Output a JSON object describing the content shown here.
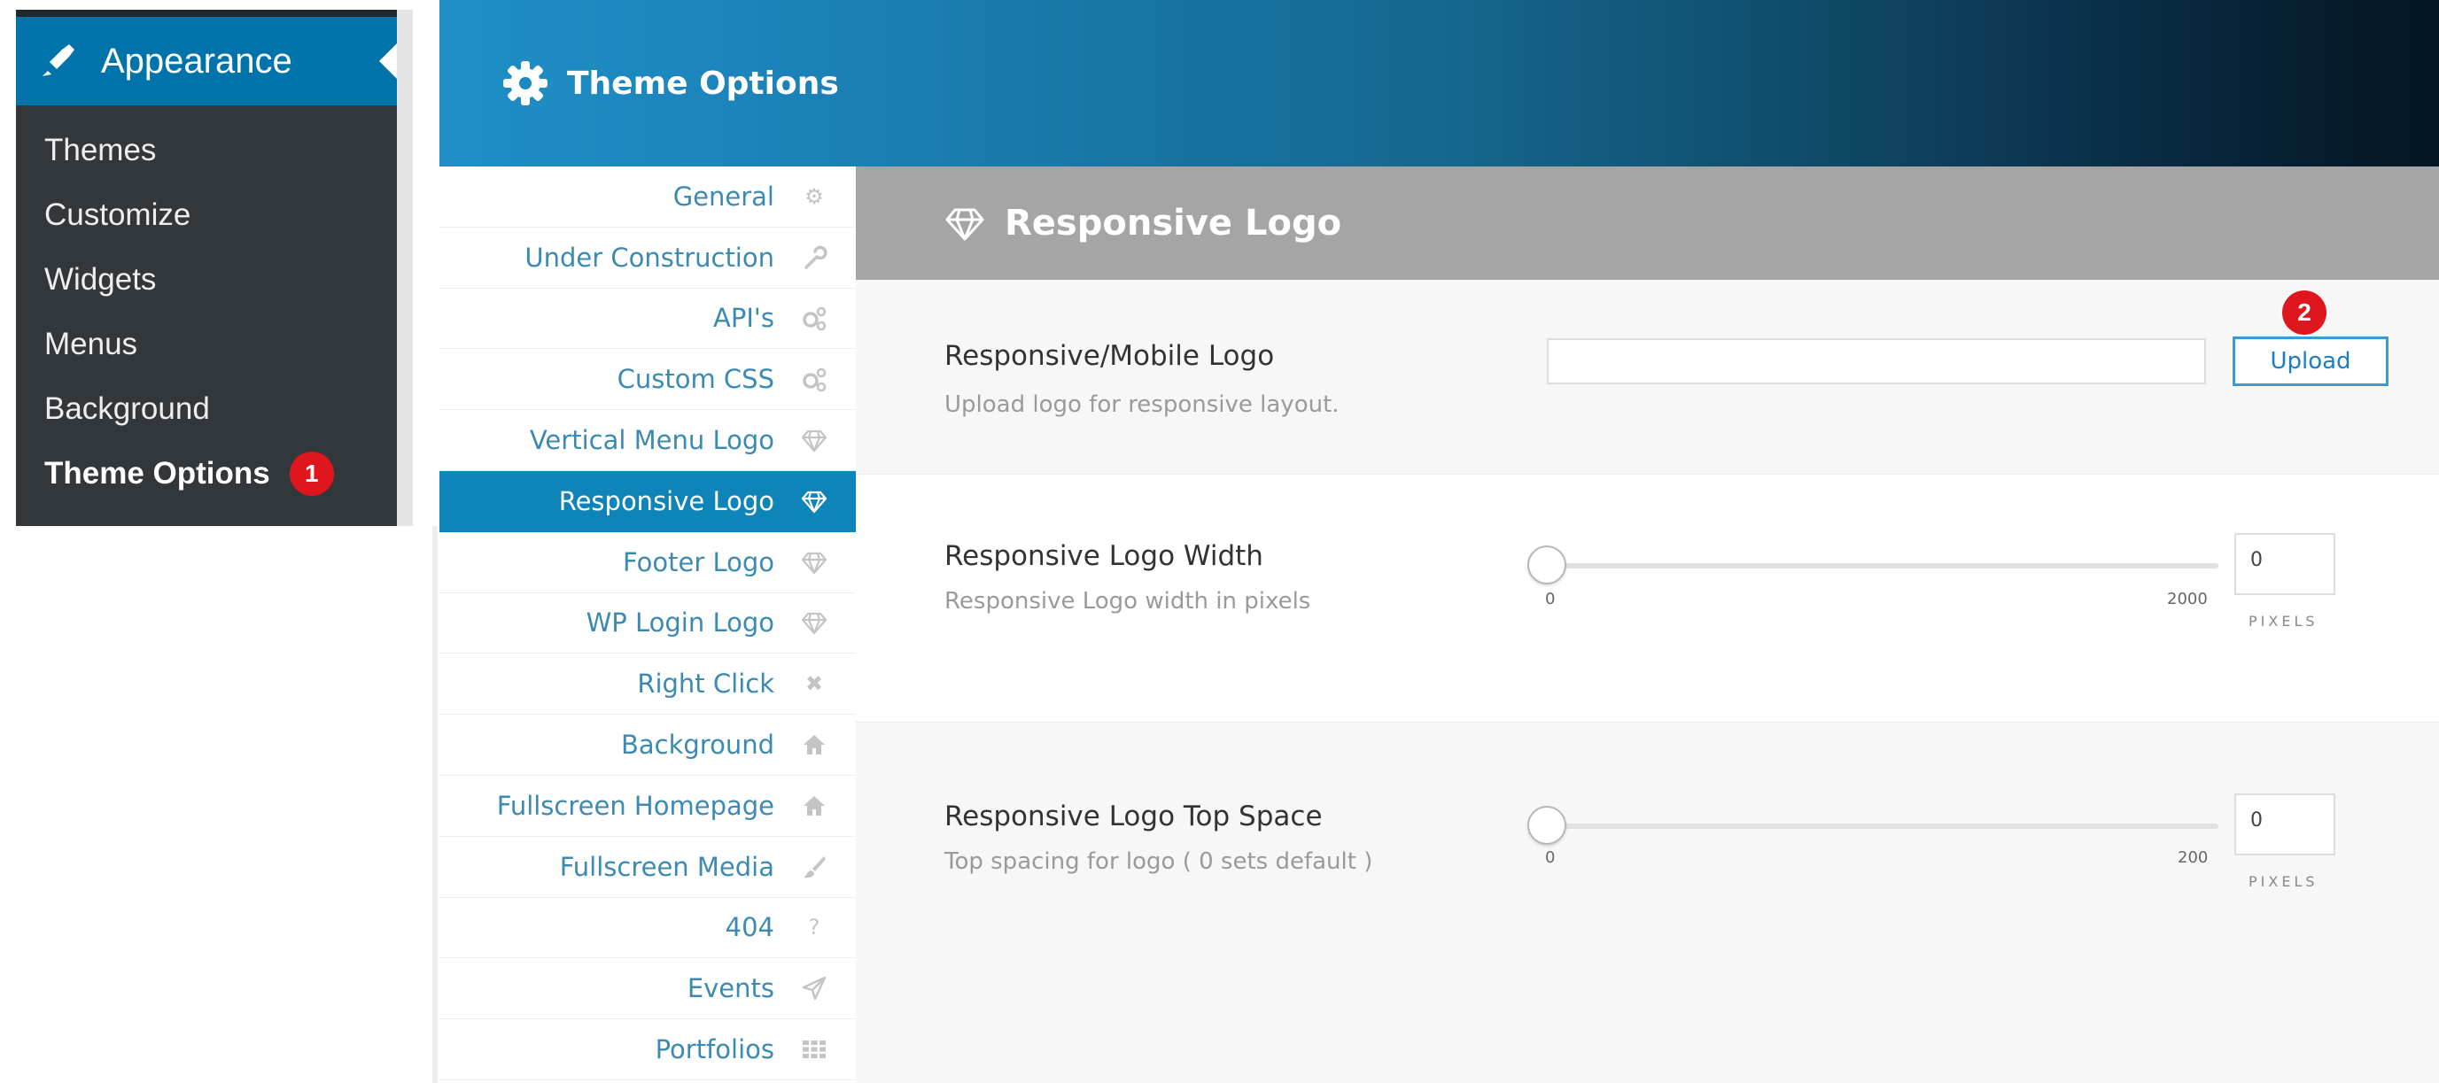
{
  "wp_menu": {
    "section_title": "Appearance",
    "section_icon": "paintbrush-icon",
    "items": [
      {
        "label": "Themes"
      },
      {
        "label": "Customize"
      },
      {
        "label": "Widgets"
      },
      {
        "label": "Menus"
      },
      {
        "label": "Background"
      },
      {
        "label": "Theme Options",
        "current": true
      }
    ],
    "current_badge": "1"
  },
  "theme_options": {
    "title": "Theme Options",
    "title_icon": "gear-icon",
    "nav": [
      {
        "label": "General",
        "icon": "gear-icon"
      },
      {
        "label": "Under Construction",
        "icon": "wrench-icon"
      },
      {
        "label": "API's",
        "icon": "gears-icon"
      },
      {
        "label": "Custom CSS",
        "icon": "gears-icon"
      },
      {
        "label": "Vertical Menu Logo",
        "icon": "diamond-icon"
      },
      {
        "label": "Responsive Logo",
        "icon": "diamond-icon",
        "active": true
      },
      {
        "label": "Footer Logo",
        "icon": "diamond-icon"
      },
      {
        "label": "WP Login Logo",
        "icon": "diamond-icon"
      },
      {
        "label": "Right Click",
        "icon": "close-icon"
      },
      {
        "label": "Background",
        "icon": "home-icon"
      },
      {
        "label": "Fullscreen Homepage",
        "icon": "home-icon"
      },
      {
        "label": "Fullscreen Media",
        "icon": "brush-icon"
      },
      {
        "label": "404",
        "icon": "question-icon"
      },
      {
        "label": "Events",
        "icon": "send-icon"
      },
      {
        "label": "Portfolios",
        "icon": "grid-icon"
      }
    ],
    "section": {
      "title": "Responsive Logo",
      "icon": "diamond-icon",
      "options": {
        "logo": {
          "title": "Responsive/Mobile Logo",
          "desc": "Upload logo for responsive layout.",
          "value": "",
          "upload_label": "Upload",
          "badge": "2"
        },
        "width": {
          "title": "Responsive Logo Width",
          "desc": "Responsive Logo width in pixels",
          "min": "0",
          "max": "2000",
          "value": "0",
          "unit": "PIXELS"
        },
        "top_space": {
          "title": "Responsive Logo Top Space",
          "desc": "Top spacing for logo ( 0 sets default )",
          "min": "0",
          "max": "200",
          "value": "0",
          "unit": "PIXELS"
        }
      }
    }
  },
  "colors": {
    "wp_accent": "#0073aa",
    "active_nav": "#0f84b8",
    "badge": "#e0161e",
    "nav_text": "#3b8ab3"
  }
}
